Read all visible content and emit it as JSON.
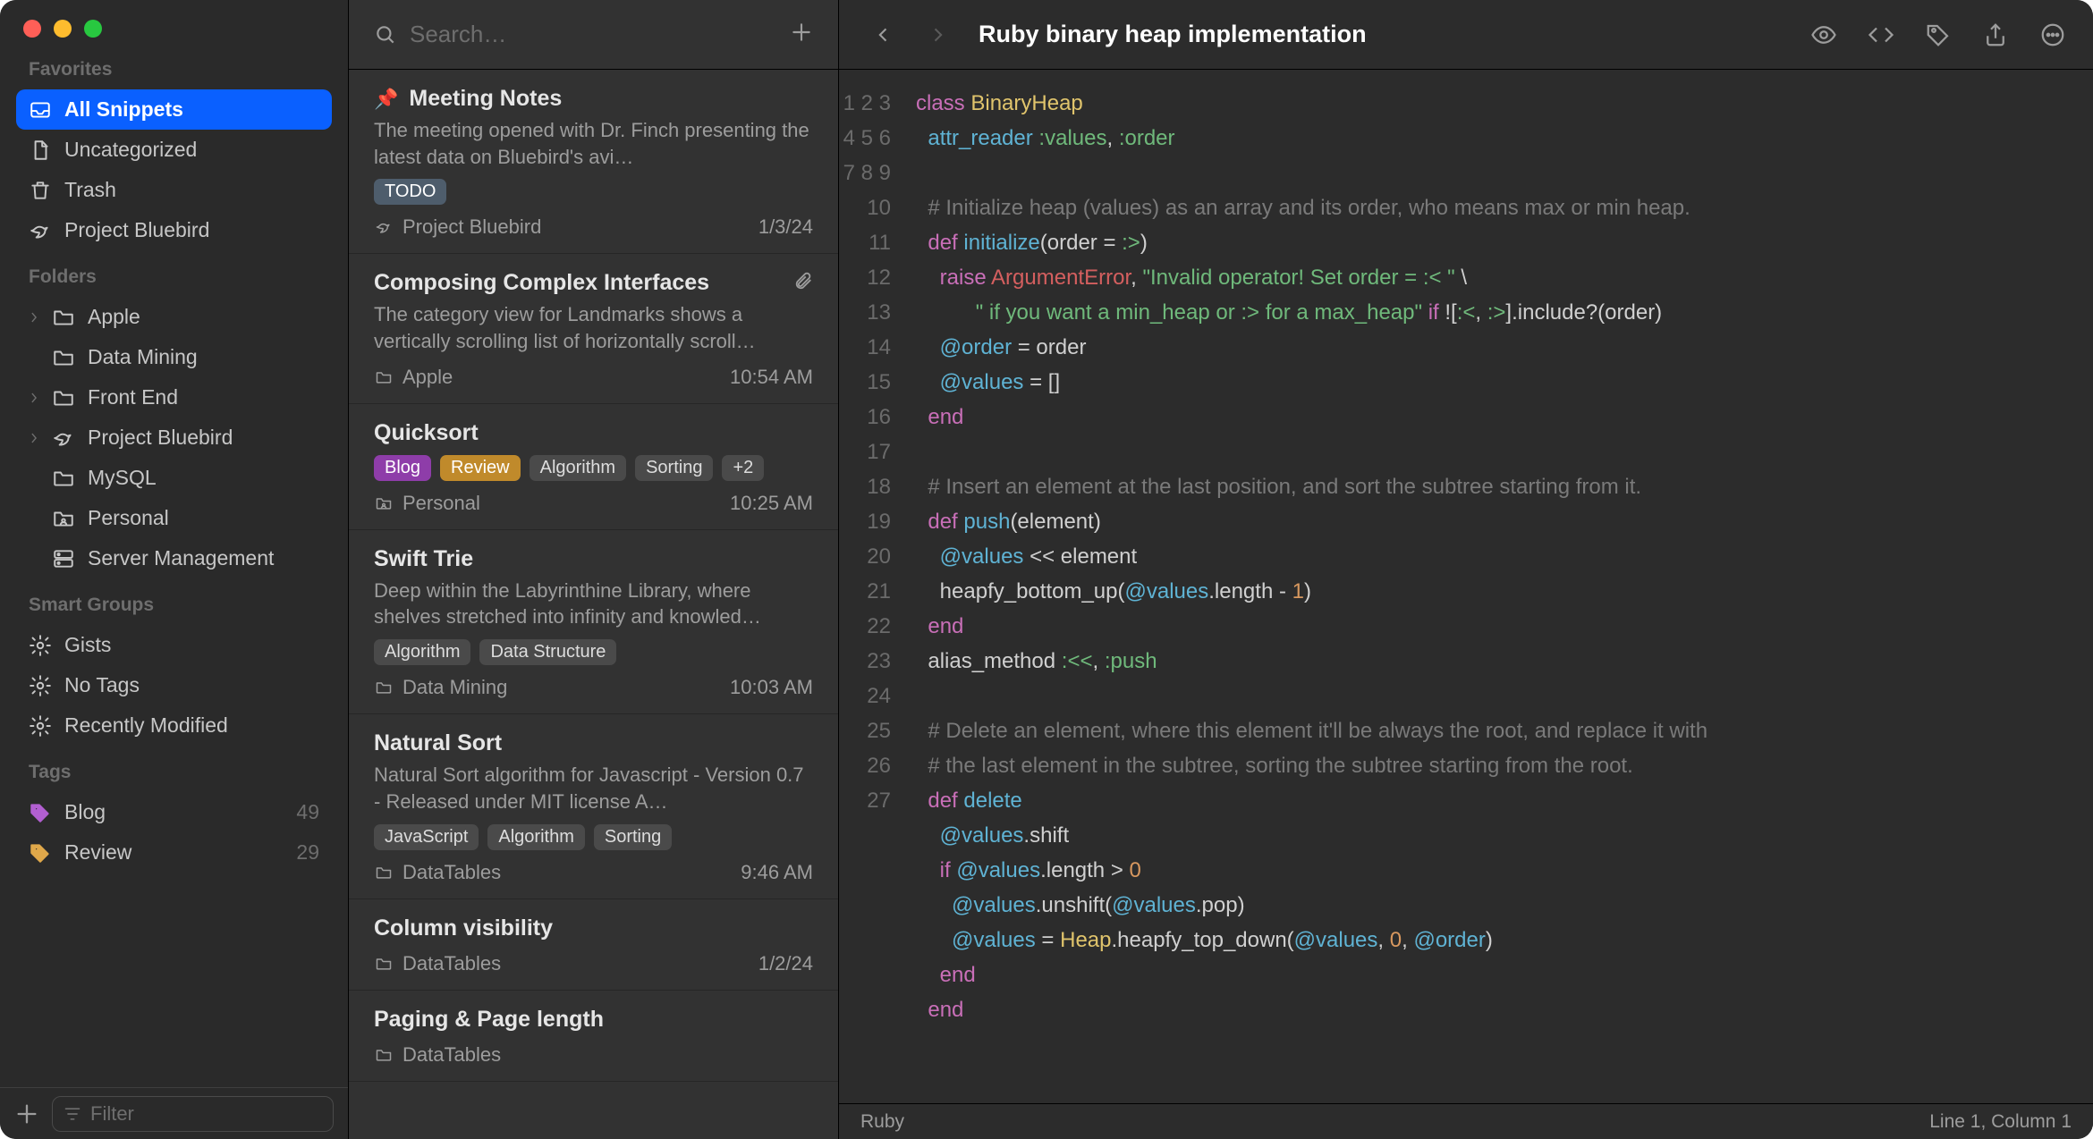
{
  "sidebar": {
    "sections": {
      "favorites": {
        "title": "Favorites",
        "items": [
          {
            "label": "All Snippets",
            "icon": "tray",
            "selected": true
          },
          {
            "label": "Uncategorized",
            "icon": "doc"
          },
          {
            "label": "Trash",
            "icon": "trash"
          },
          {
            "label": "Project Bluebird",
            "icon": "bird"
          }
        ]
      },
      "folders": {
        "title": "Folders",
        "items": [
          {
            "label": "Apple",
            "icon": "folder",
            "chevron": true
          },
          {
            "label": "Data Mining",
            "icon": "folder"
          },
          {
            "label": "Front End",
            "icon": "folder",
            "chevron": true
          },
          {
            "label": "Project Bluebird",
            "icon": "bird",
            "chevron": true
          },
          {
            "label": "MySQL",
            "icon": "folder"
          },
          {
            "label": "Personal",
            "icon": "folder-person"
          },
          {
            "label": "Server Management",
            "icon": "server"
          }
        ]
      },
      "smart": {
        "title": "Smart Groups",
        "items": [
          {
            "label": "Gists",
            "icon": "gear"
          },
          {
            "label": "No Tags",
            "icon": "gear"
          },
          {
            "label": "Recently Modified",
            "icon": "gear"
          }
        ]
      },
      "tags": {
        "title": "Tags",
        "items": [
          {
            "label": "Blog",
            "icon": "tag",
            "color": "#b25fd1",
            "count": "49"
          },
          {
            "label": "Review",
            "icon": "tag",
            "color": "#e0a84a",
            "count": "29"
          }
        ]
      }
    },
    "filter_placeholder": "Filter"
  },
  "list": {
    "search_placeholder": "Search…",
    "items": [
      {
        "pinned": true,
        "title": "Meeting Notes",
        "excerpt": "The meeting opened with Dr. Finch presenting the latest data on Bluebird's avi…",
        "tags": [
          {
            "label": "TODO",
            "color": "todo"
          }
        ],
        "folder": "Project Bluebird",
        "folder_icon": "bird",
        "time": "1/3/24"
      },
      {
        "title": "Composing Complex Interfaces",
        "excerpt": "The category view for Landmarks shows a vertically scrolling list of horizontally scroll…",
        "attachment": true,
        "tags": [],
        "folder": "Apple",
        "folder_icon": "folder",
        "time": "10:54 AM"
      },
      {
        "title": "Quicksort",
        "excerpt": "",
        "tags": [
          {
            "label": "Blog",
            "color": "blog"
          },
          {
            "label": "Review",
            "color": "review"
          },
          {
            "label": "Algorithm"
          },
          {
            "label": "Sorting"
          },
          {
            "label": "+2"
          }
        ],
        "folder": "Personal",
        "folder_icon": "folder-person",
        "time": "10:25 AM"
      },
      {
        "title": "Swift Trie",
        "excerpt": "Deep within the Labyrinthine Library, where shelves stretched into infinity and knowled…",
        "tags": [
          {
            "label": "Algorithm"
          },
          {
            "label": "Data Structure"
          }
        ],
        "folder": "Data Mining",
        "folder_icon": "folder",
        "time": "10:03 AM"
      },
      {
        "title": "Natural Sort",
        "excerpt": "Natural Sort algorithm for Javascript - Version 0.7 - Released under MIT license A…",
        "tags": [
          {
            "label": "JavaScript"
          },
          {
            "label": "Algorithm"
          },
          {
            "label": "Sorting"
          }
        ],
        "folder": "DataTables",
        "folder_icon": "folder",
        "time": "9:46 AM"
      },
      {
        "title": "Column visibility",
        "excerpt": "",
        "tags": [],
        "folder": "DataTables",
        "folder_icon": "folder",
        "time": "1/2/24"
      },
      {
        "title": "Paging & Page length",
        "excerpt": "",
        "tags": [],
        "folder": "DataTables",
        "folder_icon": "folder",
        "time": ""
      }
    ]
  },
  "editor": {
    "title": "Ruby binary heap implementation",
    "language": "Ruby",
    "cursor": "Line 1, Column 1",
    "code_lines": [
      [
        [
          "kw",
          "class"
        ],
        [
          "sp",
          " "
        ],
        [
          "cls",
          "BinaryHeap"
        ]
      ],
      [
        [
          "sp",
          "  "
        ],
        [
          "fn",
          "attr_reader"
        ],
        [
          "sp",
          " "
        ],
        [
          "sym",
          ":values"
        ],
        [
          "op",
          ", "
        ],
        [
          "sym",
          ":order"
        ]
      ],
      [],
      [
        [
          "sp",
          "  "
        ],
        [
          "cm",
          "# Initialize heap (values) as an array and its order, who means max or min heap."
        ]
      ],
      [
        [
          "sp",
          "  "
        ],
        [
          "kw",
          "def"
        ],
        [
          "sp",
          " "
        ],
        [
          "fn",
          "initialize"
        ],
        [
          "op",
          "(order = "
        ],
        [
          "sym",
          ":>"
        ],
        [
          "op",
          ")"
        ]
      ],
      [
        [
          "sp",
          "    "
        ],
        [
          "kw",
          "raise"
        ],
        [
          "sp",
          " "
        ],
        [
          "err",
          "ArgumentError"
        ],
        [
          "op",
          ", "
        ],
        [
          "str",
          "\"Invalid operator! Set order = :< \""
        ],
        [
          "op",
          " \\"
        ]
      ],
      [
        [
          "sp",
          "          "
        ],
        [
          "str",
          "\" if you want a min_heap or :> for a max_heap\""
        ],
        [
          "op",
          " "
        ],
        [
          "kw",
          "if"
        ],
        [
          "op",
          " !["
        ],
        [
          "sym",
          ":<"
        ],
        [
          "op",
          ", "
        ],
        [
          "sym",
          ":>"
        ],
        [
          "op",
          "].include?(order)"
        ]
      ],
      [
        [
          "sp",
          "    "
        ],
        [
          "var",
          "@order"
        ],
        [
          "op",
          " = order"
        ]
      ],
      [
        [
          "sp",
          "    "
        ],
        [
          "var",
          "@values"
        ],
        [
          "op",
          " = []"
        ]
      ],
      [
        [
          "sp",
          "  "
        ],
        [
          "kw",
          "end"
        ]
      ],
      [],
      [
        [
          "sp",
          "  "
        ],
        [
          "cm",
          "# Insert an element at the last position, and sort the subtree starting from it."
        ]
      ],
      [
        [
          "sp",
          "  "
        ],
        [
          "kw",
          "def"
        ],
        [
          "sp",
          " "
        ],
        [
          "fn",
          "push"
        ],
        [
          "op",
          "(element)"
        ]
      ],
      [
        [
          "sp",
          "    "
        ],
        [
          "var",
          "@values"
        ],
        [
          "op",
          " << element"
        ]
      ],
      [
        [
          "sp",
          "    "
        ],
        [
          "op",
          "heapfy_bottom_up("
        ],
        [
          "var",
          "@values"
        ],
        [
          "op",
          ".length - "
        ],
        [
          "num",
          "1"
        ],
        [
          "op",
          ")"
        ]
      ],
      [
        [
          "sp",
          "  "
        ],
        [
          "kw",
          "end"
        ]
      ],
      [
        [
          "sp",
          "  "
        ],
        [
          "op",
          "alias_method "
        ],
        [
          "sym",
          ":<<"
        ],
        [
          "op",
          ", "
        ],
        [
          "sym",
          ":push"
        ]
      ],
      [],
      [
        [
          "sp",
          "  "
        ],
        [
          "cm",
          "# Delete an element, where this element it'll be always the root, and replace it with"
        ]
      ],
      [
        [
          "sp",
          "  "
        ],
        [
          "cm",
          "# the last element in the subtree, sorting the subtree starting from the root."
        ]
      ],
      [
        [
          "sp",
          "  "
        ],
        [
          "kw",
          "def"
        ],
        [
          "sp",
          " "
        ],
        [
          "fn",
          "delete"
        ]
      ],
      [
        [
          "sp",
          "    "
        ],
        [
          "var",
          "@values"
        ],
        [
          "op",
          ".shift"
        ]
      ],
      [
        [
          "sp",
          "    "
        ],
        [
          "kw",
          "if"
        ],
        [
          "sp",
          " "
        ],
        [
          "var",
          "@values"
        ],
        [
          "op",
          ".length > "
        ],
        [
          "num",
          "0"
        ]
      ],
      [
        [
          "sp",
          "      "
        ],
        [
          "var",
          "@values"
        ],
        [
          "op",
          ".unshift("
        ],
        [
          "var",
          "@values"
        ],
        [
          "op",
          ".pop)"
        ]
      ],
      [
        [
          "sp",
          "      "
        ],
        [
          "var",
          "@values"
        ],
        [
          "op",
          " = "
        ],
        [
          "cls",
          "Heap"
        ],
        [
          "op",
          ".heapfy_top_down("
        ],
        [
          "var",
          "@values"
        ],
        [
          "op",
          ", "
        ],
        [
          "num",
          "0"
        ],
        [
          "op",
          ", "
        ],
        [
          "var",
          "@order"
        ],
        [
          "op",
          ")"
        ]
      ],
      [
        [
          "sp",
          "    "
        ],
        [
          "kw",
          "end"
        ]
      ],
      [
        [
          "sp",
          "  "
        ],
        [
          "kw",
          "end"
        ]
      ]
    ]
  }
}
